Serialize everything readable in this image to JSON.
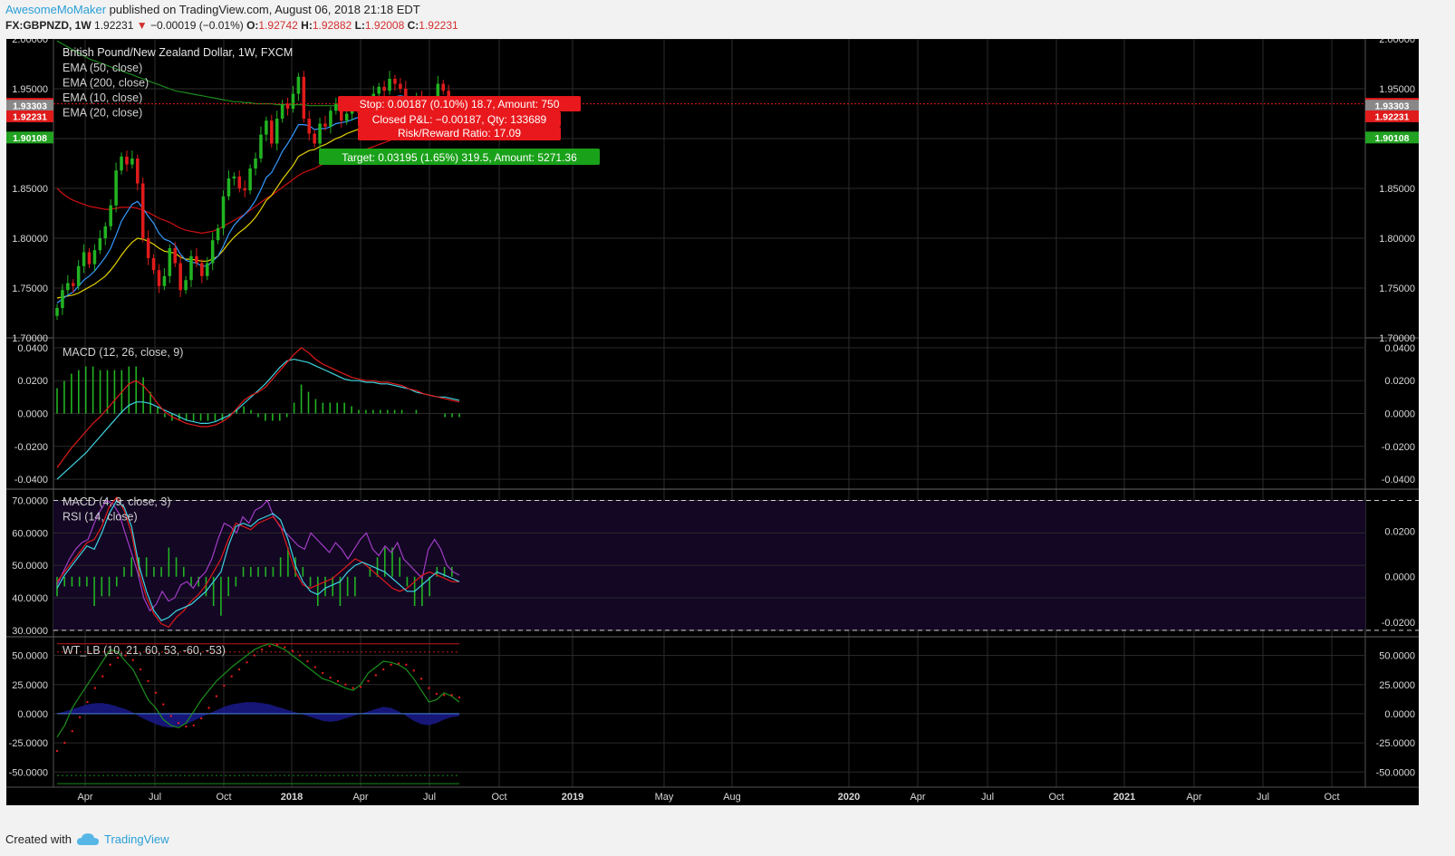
{
  "header": {
    "author": "AwesomeMoMaker",
    "published_text": "published on TradingView.com, August 06, 2018 21:18 EDT",
    "symbol": "FX:GBPNZD, 1W",
    "last": "1.92231",
    "change": "−0.00019 (−0.01%)",
    "o_label": "O:",
    "o": "1.92742",
    "h_label": "H:",
    "h": "1.92882",
    "l_label": "L:",
    "l": "1.92008",
    "c_label": "C:",
    "c": "1.92231"
  },
  "footer": {
    "created_with": "Created with",
    "brand": "TradingView"
  },
  "colors": {
    "bg": "#000000",
    "up": "#22b322",
    "down": "#e01b1b",
    "ema_fast": "#3399ff",
    "ema_yellow": "#e6d200",
    "ema_red": "#d01010",
    "ema_green": "#1c8a1c",
    "macd_line": "#3fd3e0",
    "signal_line": "#e01b1b",
    "rsi_line": "#a23cc4",
    "rsi_band": "#130724",
    "wt_green": "#1d8f1d",
    "wt_blue": "#1a1a8c"
  },
  "chart_data": {
    "type": "candlestick",
    "x_ticks": [
      "Apr",
      "Jul",
      "Oct",
      "2018",
      "Apr",
      "Jul",
      "Oct",
      "2019",
      "May",
      "Aug",
      "2020",
      "Apr",
      "Jul",
      "Oct",
      "2021",
      "Apr",
      "Jul",
      "Oct"
    ],
    "price_pane": {
      "title": "British Pound/New Zealand Dollar, 1W, FXCM",
      "legend": [
        "EMA (50, close)",
        "EMA (200, close)",
        "EMA (10, close)",
        "EMA (20, close)"
      ],
      "y_ticks": [
        "2.00000",
        "1.95000",
        "1.90000",
        "1.85000",
        "1.80000",
        "1.75000",
        "1.70000"
      ],
      "ylim": [
        1.7,
        2.0
      ],
      "price_tags": [
        {
          "value": 1.9349,
          "label": "1.93490",
          "color": "#e01b1b"
        },
        {
          "value": 1.93303,
          "label": "1.93303",
          "color": "#888888"
        },
        {
          "value": 1.92231,
          "label": "1.92231",
          "color": "#e01b1b"
        },
        {
          "value": 1.90108,
          "label": "1.90108",
          "color": "#22a322"
        }
      ],
      "position_labels": {
        "stop": "Stop: 0.00187 (0.10%) 18.7, Amount: 750",
        "closed": "Closed P&L: −0.00187, Qty: 133689",
        "risk": "Risk/Reward Ratio: 17.09",
        "target": "Target: 0.03195 (1.65%) 319.5, Amount: 5271.36"
      },
      "closes": [
        1.73,
        1.748,
        1.755,
        1.752,
        1.772,
        1.786,
        1.774,
        1.788,
        1.8,
        1.812,
        1.833,
        1.868,
        1.882,
        1.874,
        1.88,
        1.855,
        1.8,
        1.78,
        1.768,
        1.752,
        1.762,
        1.79,
        1.775,
        1.748,
        1.758,
        1.782,
        1.775,
        1.762,
        1.775,
        1.798,
        1.81,
        1.842,
        1.86,
        1.862,
        1.85,
        1.848,
        1.87,
        1.88,
        1.904,
        1.918,
        1.895,
        1.92,
        1.935,
        1.93,
        1.945,
        1.962,
        1.92,
        1.905,
        1.895,
        1.915,
        1.912,
        1.928,
        1.935,
        1.918,
        1.925,
        1.932,
        1.93,
        1.922,
        1.935,
        1.945,
        1.952,
        1.948,
        1.96,
        1.955,
        1.95,
        1.938,
        1.925,
        1.94,
        1.935,
        1.92,
        1.93,
        1.955,
        1.948,
        1.93,
        1.925,
        1.922
      ],
      "ema10": [
        1.735,
        1.739,
        1.743,
        1.746,
        1.752,
        1.758,
        1.762,
        1.767,
        1.774,
        1.781,
        1.79,
        1.803,
        1.817,
        1.826,
        1.834,
        1.837,
        1.83,
        1.822,
        1.815,
        1.805,
        1.799,
        1.797,
        1.793,
        1.784,
        1.778,
        1.776,
        1.775,
        1.772,
        1.772,
        1.777,
        1.782,
        1.792,
        1.804,
        1.813,
        1.819,
        1.824,
        1.83,
        1.838,
        1.849,
        1.861,
        1.866,
        1.876,
        1.887,
        1.895,
        1.904,
        1.914,
        1.914,
        1.913,
        1.909,
        1.91,
        1.91,
        1.912,
        1.915,
        1.916,
        1.917,
        1.919,
        1.921,
        1.921,
        1.923,
        1.926,
        1.931,
        1.934,
        1.939,
        1.942,
        1.943,
        1.942,
        1.939,
        1.94,
        1.939,
        1.935,
        1.934,
        1.938,
        1.94,
        1.938,
        1.936,
        1.934
      ],
      "ema20": [
        1.74,
        1.741,
        1.742,
        1.743,
        1.745,
        1.748,
        1.751,
        1.754,
        1.758,
        1.762,
        1.768,
        1.775,
        1.783,
        1.79,
        1.796,
        1.8,
        1.799,
        1.797,
        1.794,
        1.79,
        1.787,
        1.786,
        1.785,
        1.781,
        1.779,
        1.779,
        1.778,
        1.777,
        1.777,
        1.779,
        1.782,
        1.788,
        1.795,
        1.801,
        1.806,
        1.81,
        1.815,
        1.821,
        1.829,
        1.838,
        1.843,
        1.851,
        1.859,
        1.866,
        1.873,
        1.882,
        1.885,
        1.888,
        1.889,
        1.892,
        1.894,
        1.897,
        1.9,
        1.902,
        1.905,
        1.907,
        1.909,
        1.91,
        1.912,
        1.915,
        1.918,
        1.921,
        1.924,
        1.926,
        1.927,
        1.928,
        1.928,
        1.929,
        1.93,
        1.929,
        1.929,
        1.931,
        1.932,
        1.932,
        1.931,
        1.931
      ],
      "ema50": [
        1.85,
        1.845,
        1.841,
        1.838,
        1.836,
        1.834,
        1.832,
        1.831,
        1.83,
        1.829,
        1.829,
        1.83,
        1.831,
        1.831,
        1.831,
        1.83,
        1.828,
        1.826,
        1.823,
        1.82,
        1.818,
        1.816,
        1.813,
        1.81,
        1.808,
        1.807,
        1.806,
        1.805,
        1.806,
        1.807,
        1.809,
        1.812,
        1.815,
        1.818,
        1.821,
        1.824,
        1.828,
        1.832,
        1.836,
        1.84,
        1.843,
        1.847,
        1.851,
        1.855,
        1.859,
        1.863,
        1.866,
        1.868,
        1.87,
        1.873,
        1.875,
        1.877,
        1.879,
        1.881,
        1.883,
        1.885,
        1.887,
        1.888,
        1.89,
        1.892,
        1.894,
        1.896,
        1.898,
        1.9,
        1.902,
        1.904,
        1.905,
        1.907,
        1.909,
        1.91,
        1.911,
        1.913,
        1.915,
        1.916,
        1.917,
        1.918
      ],
      "ema200": [
        1.998,
        1.995,
        1.992,
        1.989,
        1.986,
        1.983,
        1.98,
        1.978,
        1.976,
        1.974,
        1.972,
        1.97,
        1.968,
        1.966,
        1.964,
        1.962,
        1.96,
        1.958,
        1.956,
        1.954,
        1.952,
        1.95,
        1.948,
        1.947,
        1.946,
        1.945,
        1.944,
        1.943,
        1.942,
        1.941,
        1.94,
        1.939,
        1.938,
        1.937,
        1.937,
        1.936,
        1.936,
        1.935,
        1.935,
        1.935,
        1.935,
        1.934,
        1.934,
        1.934,
        1.934,
        1.934,
        1.934,
        1.933,
        1.933,
        1.933,
        1.933,
        1.933,
        1.933,
        1.933,
        1.933,
        1.933,
        1.933,
        1.933,
        1.933,
        1.933,
        1.933,
        1.933,
        1.933,
        1.933,
        1.933,
        1.933,
        1.933,
        1.933,
        1.933,
        1.933,
        1.933,
        1.933,
        1.933,
        1.933,
        1.933,
        1.933
      ]
    },
    "macd_pane": {
      "legend": [
        "MACD (12, 26, close, 9)"
      ],
      "y_ticks": [
        "0.0400",
        "0.0200",
        "0.0000",
        "-0.0200",
        "-0.0400"
      ],
      "ylim": [
        -0.042,
        0.042
      ],
      "macd": [
        -0.033,
        -0.027,
        -0.021,
        -0.016,
        -0.011,
        -0.006,
        -0.002,
        0.003,
        0.008,
        0.013,
        0.018,
        0.02,
        0.017,
        0.012,
        0.006,
        0.001,
        -0.002,
        -0.004,
        -0.006,
        -0.007,
        -0.008,
        -0.008,
        -0.007,
        -0.005,
        -0.002,
        0.003,
        0.008,
        0.011,
        0.013,
        0.016,
        0.021,
        0.026,
        0.031,
        0.036,
        0.04,
        0.037,
        0.033,
        0.03,
        0.028,
        0.026,
        0.024,
        0.022,
        0.021,
        0.02,
        0.02,
        0.019,
        0.019,
        0.018,
        0.017,
        0.015,
        0.014,
        0.012,
        0.011,
        0.01,
        0.009,
        0.008,
        0.007
      ],
      "signal": [
        -0.04,
        -0.036,
        -0.032,
        -0.028,
        -0.024,
        -0.019,
        -0.014,
        -0.009,
        -0.004,
        0.001,
        0.005,
        0.007,
        0.007,
        0.006,
        0.004,
        0.002,
        0.0,
        -0.002,
        -0.004,
        -0.005,
        -0.006,
        -0.006,
        -0.005,
        -0.003,
        -0.001,
        0.002,
        0.006,
        0.01,
        0.014,
        0.018,
        0.023,
        0.028,
        0.032,
        0.033,
        0.032,
        0.031,
        0.029,
        0.027,
        0.025,
        0.023,
        0.021,
        0.02,
        0.02,
        0.019,
        0.019,
        0.018,
        0.018,
        0.017,
        0.016,
        0.015,
        0.013,
        0.012,
        0.011,
        0.01,
        0.01,
        0.009,
        0.008
      ]
    },
    "rsi_pane": {
      "legend": [
        "MACD (4, 9, close, 3)",
        "RSI (14, close)"
      ],
      "y_ticks_left": [
        "70.0000",
        "60.0000",
        "50.0000",
        "40.0000",
        "30.0000"
      ],
      "y_ticks_right": [
        "0.0200",
        "0.0000",
        "-0.0200"
      ],
      "ylim": [
        29,
        72
      ],
      "rsi": [
        44,
        48,
        52,
        55,
        57,
        58,
        63,
        67,
        70,
        69,
        66,
        60,
        54,
        48,
        40,
        36,
        38,
        42,
        39,
        40,
        44,
        45,
        43,
        46,
        48,
        52,
        58,
        63,
        62,
        60,
        65,
        63,
        67,
        68,
        70,
        65,
        62,
        60,
        58,
        56,
        55,
        60,
        58,
        56,
        54,
        57,
        55,
        52,
        55,
        58,
        60,
        55,
        53,
        56,
        54,
        57,
        52,
        50,
        48,
        46,
        55,
        58,
        55,
        50,
        48,
        47
      ],
      "macd_fast": [
        43,
        47,
        50,
        53,
        56,
        55,
        60,
        66,
        70,
        68,
        62,
        50,
        42,
        36,
        33,
        34,
        36,
        37,
        38,
        40,
        42,
        45,
        48,
        56,
        62,
        63,
        62,
        64,
        65,
        66,
        64,
        58,
        50,
        45,
        42,
        41,
        43,
        44,
        45,
        48,
        50,
        51,
        50,
        49,
        48,
        46,
        44,
        42,
        42,
        44,
        46,
        48,
        47,
        46,
        45
      ],
      "macd_slow": [
        45,
        48,
        51,
        54,
        57,
        58,
        62,
        68,
        71,
        67,
        60,
        48,
        40,
        35,
        32,
        31,
        34,
        36,
        39,
        41,
        44,
        48,
        52,
        58,
        63,
        62,
        61,
        63,
        64,
        65,
        62,
        55,
        48,
        44,
        43,
        44,
        45,
        46,
        48,
        50,
        52,
        51,
        49,
        47,
        45,
        43,
        42,
        43,
        45,
        47,
        48,
        47,
        46,
        45,
        45
      ]
    },
    "wt_pane": {
      "legend": [
        "WT_LB (10, 21, 60, 53, -60, -53)"
      ],
      "y_ticks": [
        "50.0000",
        "25.0000",
        "0.0000",
        "-25.0000",
        "-50.0000"
      ],
      "ylim": [
        -63,
        66
      ],
      "wt1": [
        -20,
        -10,
        5,
        15,
        25,
        35,
        45,
        55,
        53,
        45,
        38,
        25,
        12,
        5,
        -5,
        -10,
        -12,
        -8,
        2,
        12,
        20,
        28,
        34,
        40,
        45,
        50,
        55,
        58,
        60,
        58,
        55,
        50,
        45,
        40,
        35,
        30,
        28,
        25,
        22,
        20,
        25,
        35,
        40,
        45,
        44,
        42,
        38,
        30,
        20,
        10,
        12,
        18,
        15,
        10
      ],
      "wt2": [
        -32,
        -25,
        -15,
        -3,
        10,
        22,
        32,
        42,
        48,
        50,
        46,
        38,
        28,
        18,
        8,
        -2,
        -8,
        -11,
        -10,
        -4,
        5,
        15,
        24,
        32,
        38,
        44,
        50,
        55,
        58,
        59,
        57,
        54,
        50,
        45,
        40,
        35,
        31,
        28,
        25,
        22,
        23,
        28,
        33,
        38,
        42,
        43,
        42,
        37,
        30,
        22,
        17,
        16,
        16,
        14
      ],
      "momentum": [
        0,
        2,
        4,
        6,
        8,
        9,
        9,
        8,
        6,
        4,
        1,
        -3,
        -6,
        -9,
        -11,
        -12,
        -11,
        -9,
        -6,
        -3,
        0,
        3,
        6,
        8,
        9,
        10,
        10,
        9,
        8,
        6,
        4,
        2,
        0,
        -2,
        -4,
        -6,
        -7,
        -6,
        -4,
        -2,
        0,
        2,
        4,
        6,
        5,
        2,
        -2,
        -6,
        -9,
        -10,
        -8,
        -5,
        -3,
        -2
      ]
    }
  }
}
